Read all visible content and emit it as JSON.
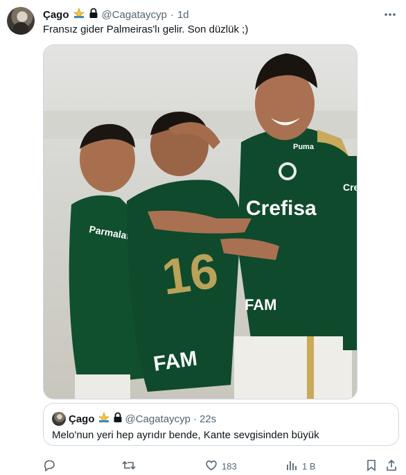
{
  "tweet": {
    "author_name": "Çago",
    "handle": "@Cagataycyp",
    "separator": "·",
    "time": "1d",
    "text": "Fransız gider Palmeiras'lı gelir. Son düzlük ;)",
    "media": {
      "jersey_texts": [
        "Parmalat",
        "Crefisa",
        "FAM",
        "16",
        "Puma",
        "Crefisa",
        "FAM"
      ]
    }
  },
  "quote": {
    "author_name": "Çago",
    "handle": "@Cagataycyp",
    "separator": "·",
    "time": "22s",
    "text": "Melo'nun yeri hep ayrıdır bende, Kante sevgisinden büyük"
  },
  "actions": {
    "reply_count": "",
    "retweet_count": "",
    "like_count": "183",
    "views_count": "1 B"
  },
  "colors": {
    "text_primary": "#0f1419",
    "text_secondary": "#536471",
    "border": "#cfd9de",
    "jersey_green": "#0f4a2c"
  },
  "icons": [
    "verified-emoji-icon",
    "lock-icon",
    "more-icon",
    "reply-icon",
    "retweet-icon",
    "like-icon",
    "views-icon",
    "bookmark-icon",
    "share-icon"
  ]
}
